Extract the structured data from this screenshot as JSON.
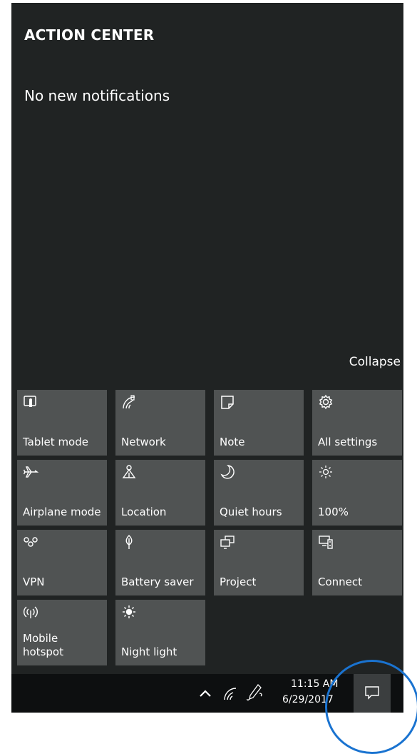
{
  "header": {
    "title": "ACTION CENTER",
    "no_notifications": "No new notifications",
    "collapse_label": "Collapse"
  },
  "tiles": [
    {
      "label": "Tablet mode",
      "icon": "tablet-mode-icon"
    },
    {
      "label": "Network",
      "icon": "network-icon"
    },
    {
      "label": "Note",
      "icon": "note-icon"
    },
    {
      "label": "All settings",
      "icon": "gear-icon"
    },
    {
      "label": "Airplane mode",
      "icon": "airplane-icon"
    },
    {
      "label": "Location",
      "icon": "location-icon"
    },
    {
      "label": "Quiet hours",
      "icon": "moon-icon"
    },
    {
      "label": "100%",
      "icon": "brightness-icon"
    },
    {
      "label": "VPN",
      "icon": "vpn-icon"
    },
    {
      "label": "Battery saver",
      "icon": "battery-saver-icon"
    },
    {
      "label": "Project",
      "icon": "project-icon"
    },
    {
      "label": "Connect",
      "icon": "connect-icon"
    },
    {
      "label": "Mobile\nhotspot",
      "icon": "mobile-hotspot-icon"
    },
    {
      "label": "Night light",
      "icon": "night-light-icon"
    }
  ],
  "taskbar": {
    "time": "11:15 AM",
    "date": "6/29/2017",
    "icons": [
      "chevron-up-icon",
      "wifi-icon",
      "pen-icon",
      "action-center-icon"
    ]
  },
  "colors": {
    "panel_bg": "#202323",
    "tile_bg": "#505353",
    "taskbar_bg": "#0d0f10",
    "highlight_ring": "#1a73d0"
  }
}
